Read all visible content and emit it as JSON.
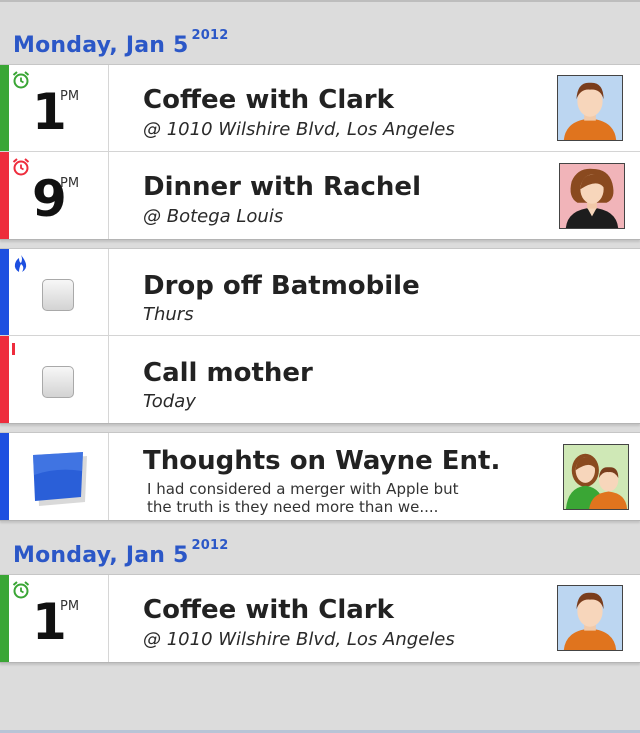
{
  "colors": {
    "accent": "#2b57c7",
    "green": "#3aa635",
    "red": "#ee2c3c",
    "blue": "#1d4fe0"
  },
  "sections": [
    {
      "day": "Monday, Jan 5",
      "year": "2012"
    },
    {
      "day": "Monday, Jan 5",
      "year": "2012"
    }
  ],
  "events": [
    {
      "hour": "1",
      "ampm": "PM",
      "title": "Coffee with Clark",
      "subtitle": "@ 1010 Wilshire Blvd, Los Angeles",
      "icon": "alarm-clock-icon",
      "avatar": "man-avatar"
    },
    {
      "hour": "9",
      "ampm": "PM",
      "title": "Dinner with Rachel",
      "subtitle": "@ Botega Louis",
      "icon": "alarm-clock-icon",
      "avatar": "woman-avatar"
    }
  ],
  "tasks": [
    {
      "title": "Drop off Batmobile",
      "subtitle": "Thurs",
      "icon": "flame-icon"
    },
    {
      "title": "Call mother",
      "subtitle": "Today",
      "icon": "exclamation-icon"
    }
  ],
  "note": {
    "title": "Thoughts on Wayne Ent.",
    "line1": "I had considered a merger with Apple but",
    "line2": "the truth is they need more than we....",
    "icon": "sticky-note-icon",
    "avatar": "couple-avatar"
  },
  "events2": [
    {
      "hour": "1",
      "ampm": "PM",
      "title": "Coffee with Clark",
      "subtitle": "@ 1010 Wilshire Blvd, Los Angeles",
      "icon": "alarm-clock-icon",
      "avatar": "man-avatar"
    }
  ]
}
